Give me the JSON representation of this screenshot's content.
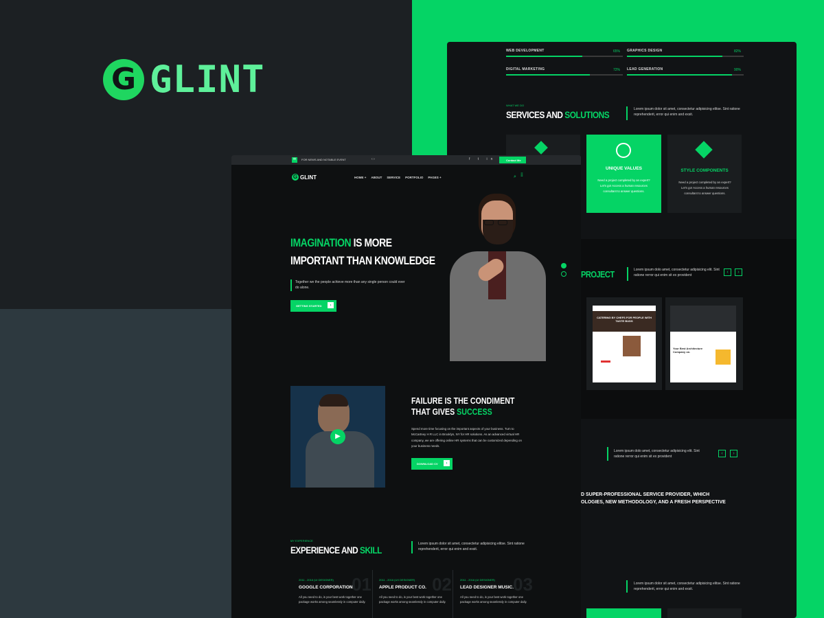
{
  "brand": {
    "logo_letter": "G",
    "logo_text": "GLINT",
    "accent": "#05d465",
    "nav_logo_text": "GLINT"
  },
  "back_page": {
    "skills": [
      {
        "label": "WEB DEVELOPMENT",
        "pct_label": "65%",
        "value": 0.65
      },
      {
        "label": "GRAPHICS DESIGN",
        "pct_label": "82%",
        "value": 0.82
      },
      {
        "label": "DIGITAL MARKETING",
        "pct_label": "72%",
        "value": 0.72
      },
      {
        "label": "LEAD GENERATION",
        "pct_label": "90%",
        "value": 0.9
      }
    ],
    "services": {
      "kicker": "WHAT WE DO",
      "title_a": "SERVICES AND ",
      "title_b": "SOLUTIONS",
      "desc": "Lorem ipsum dolor sit amet, consectetur adipisicing elitse. Sint ratione reprehenderit, error qui enim and exsit.",
      "cards": [
        {
          "title": "UNIQUE VALUES",
          "text": "Need a project completed by an expert? Let's go! Access a human resources consultant to answer questions."
        },
        {
          "title": "STYLE COMPONENTS",
          "text": "Need a project completed by an expert? Let's go! Access a human resources consultant to answer questions."
        }
      ]
    },
    "project": {
      "title": "PROJECT",
      "desc": "Lorem ipsum dolo amet, consectetur adipisicing elit. Sint ratione rerror qui enim sit ex provident",
      "mock1_title": "CATERING BY CHEFS FOR PEOPLE WITH TASTE BUDS",
      "mock2_title": "Your Best Architecture Company on."
    },
    "testimonial": {
      "desc": "Lorem ipsum dolo amet, consectetur adipisicing elit. Sint ratione rerror qui enim sit ex provident",
      "line1": "D SUPER-PROFESSIONAL SERVICE PROVIDER, WHICH",
      "line2": "OLOGIES, NEW METHODOLOGY, AND A FRESH PERSPECTIVE"
    },
    "bottom_desc": "Lorem ipsum dolor sit amet, consectetur adipisicing elitse. Sint ratione reprehenderit, error qui enim and exsit."
  },
  "front_page": {
    "topbar_text": "FOR NEWS AND NOTABLE EVENT",
    "contact_label": "Contact Me",
    "nav": [
      "HOME +",
      "ABOUT",
      "SERVICE",
      "PORTFOLIO",
      "PAGES +"
    ],
    "hero": {
      "title_green": "IMAGINATION",
      "title_rest": " IS MORE",
      "title_line2": "IMPORTANT THAN KNOWLEDGE",
      "desc": "Together we the people achieve more than any single person could ever do alone.",
      "button": "GETTING STARTED"
    },
    "about": {
      "title_line1": "FAILURE IS THE CONDIMENT",
      "title_line2": "THAT GIVES ",
      "title_green": "SUCCESS",
      "desc": "Spend more time focusing on the important aspects of your business. Turn to McCartney H R LLC in Brooklyn, NY for HR solutions. As an advanced virtual HR company, we are offering online HR systems that can be customized depending on your business needs.",
      "button": "DOWNLOAD CV"
    },
    "experience": {
      "kicker": "MY EXPERIENCE",
      "title_a": "EXPERIENCE AND ",
      "title_b": "SKILL",
      "desc": "Lorem ipsum dolor sit amet, consectetur adipisicing elitse. Sint ratione reprehenderit, error qui enim and exsit.",
      "items": [
        {
          "years": "2011 - 2016 (UI DESIGNER)",
          "title": "GOOGLE CORPORATION.",
          "text": "All you need to do, is your best work together one package works among seamlessly in computer daily.",
          "num": "01"
        },
        {
          "years": "2011 - 2016 (UX DESIGNER)",
          "title": "APPLE PRODUCT CO.",
          "text": "All you need to do, is your best work together one package works among seamlessly in computer daily.",
          "num": "02"
        },
        {
          "years": "2011 - 2016 (UI DESIGNER)",
          "title": "LEAD DESIGNER MUSIC.",
          "text": "All you need to do, is your best work together one package works among seamlessly in computer daily.",
          "num": "03"
        }
      ]
    }
  }
}
